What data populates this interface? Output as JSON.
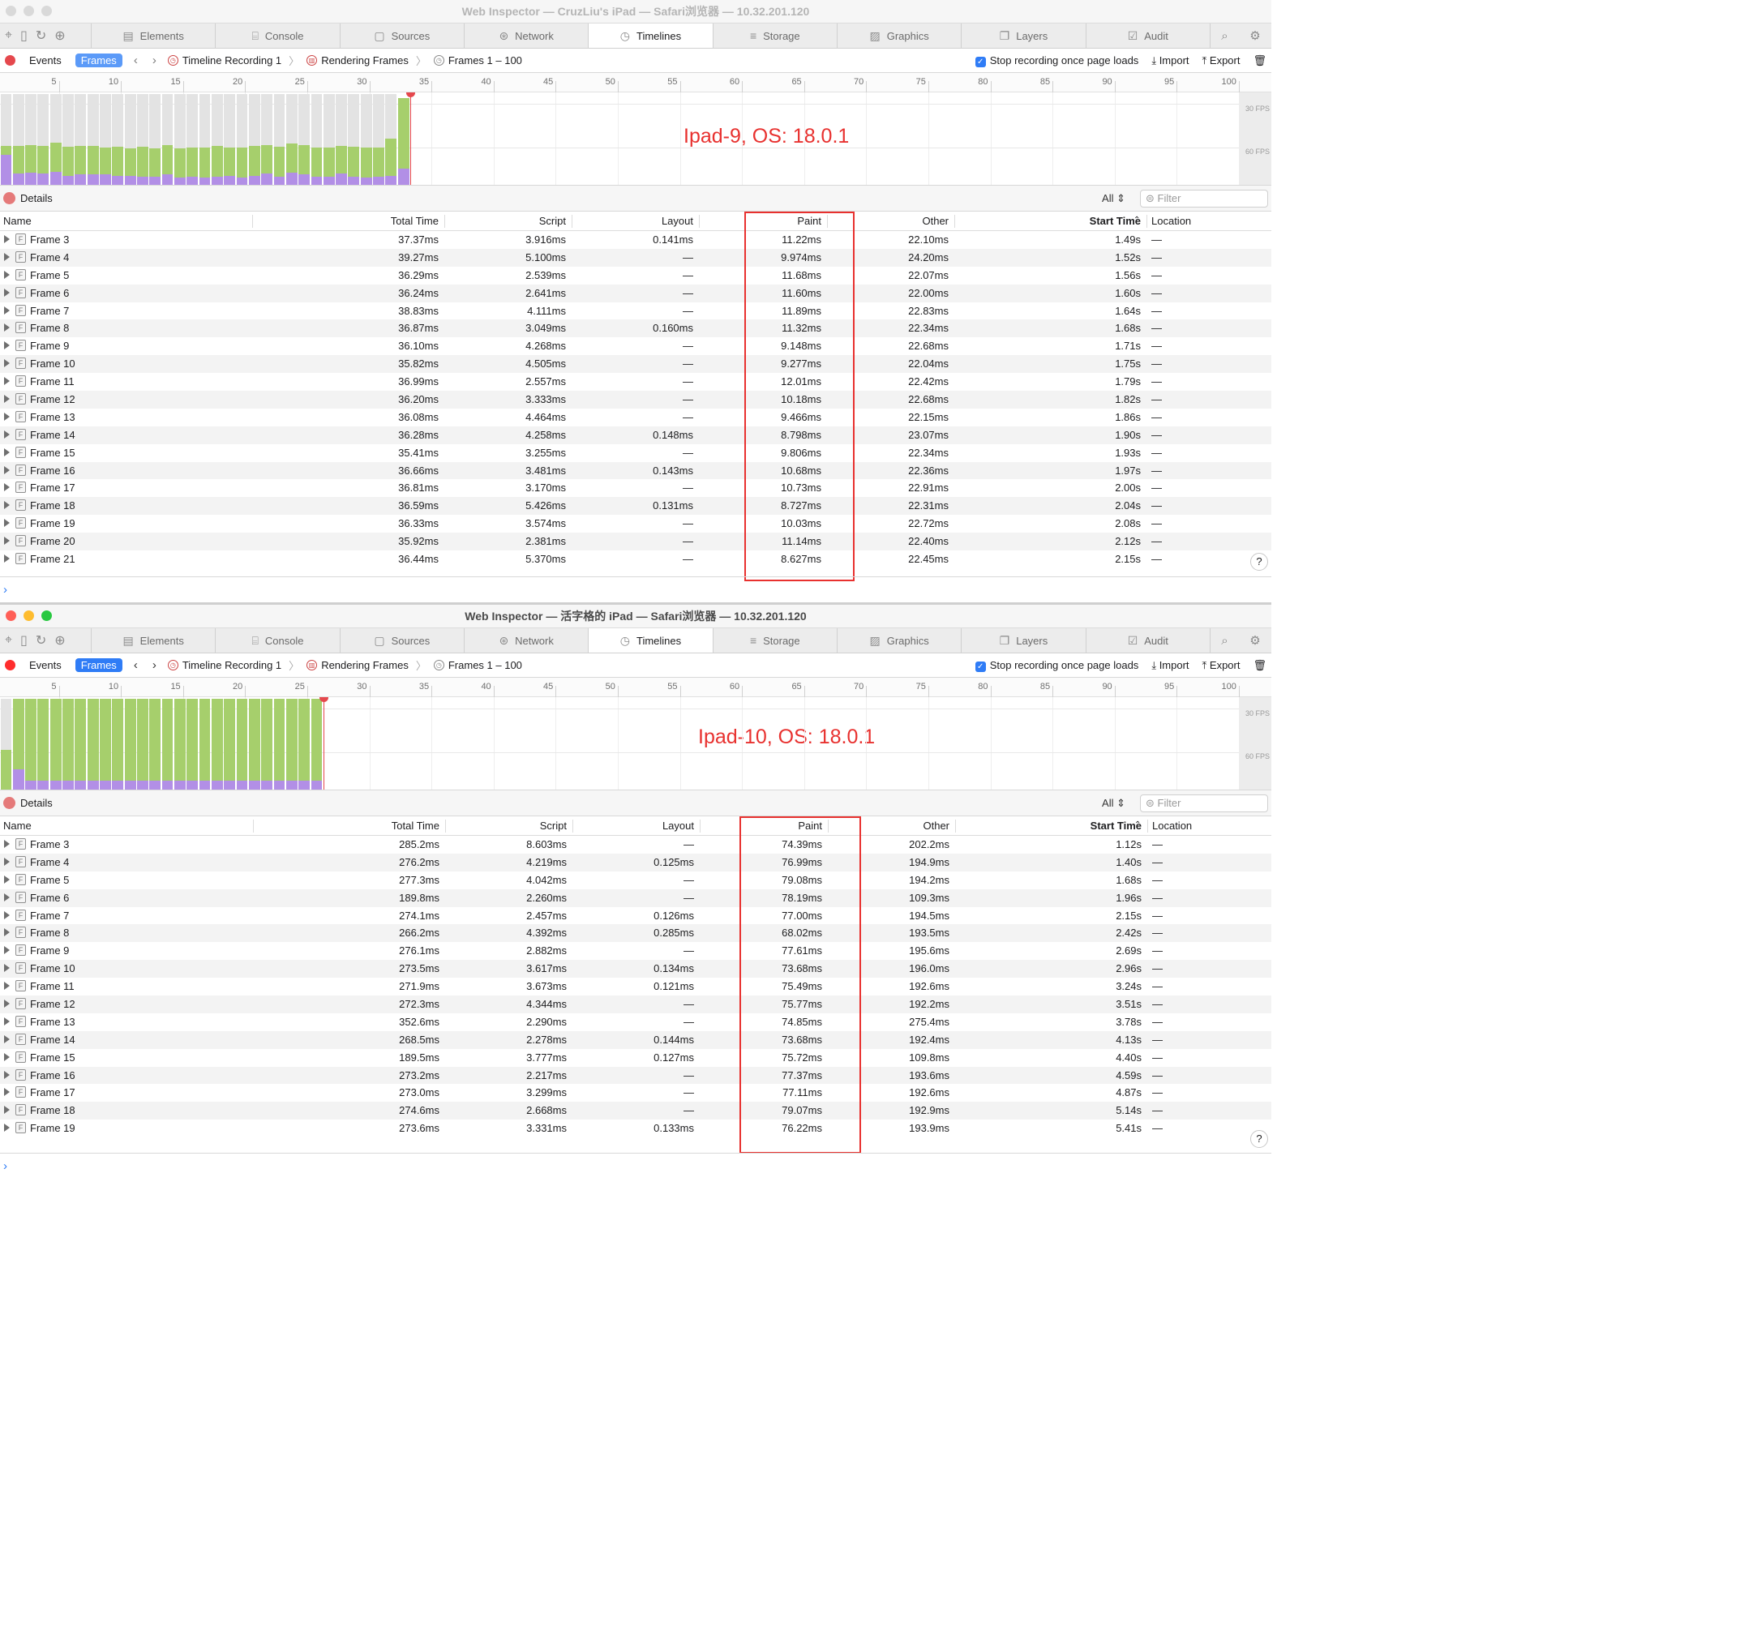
{
  "top": {
    "title": "Web Inspector — CruzLiu's iPad — Safari浏览器 — 10.32.201.120",
    "annotation": "Ipad-9, OS: 18.0.1",
    "frames_bar": {
      "fill_count": 33,
      "green_level": [
        0.42,
        0.42,
        0.43,
        0.42,
        0.45,
        0.41,
        0.42,
        0.42,
        0.4,
        0.41,
        0.39,
        0.41,
        0.39,
        0.43,
        0.39,
        0.4,
        0.4,
        0.42,
        0.4,
        0.4,
        0.42,
        0.43,
        0.41,
        0.44,
        0.43,
        0.4,
        0.4,
        0.42,
        0.41,
        0.4,
        0.4,
        0.5,
        0.93
      ],
      "purple_level": [
        0.32,
        0.12,
        0.13,
        0.12,
        0.14,
        0.1,
        0.11,
        0.11,
        0.11,
        0.1,
        0.1,
        0.09,
        0.09,
        0.11,
        0.08,
        0.09,
        0.08,
        0.09,
        0.1,
        0.08,
        0.1,
        0.12,
        0.09,
        0.13,
        0.11,
        0.09,
        0.09,
        0.12,
        0.09,
        0.08,
        0.09,
        0.1,
        0.17
      ]
    },
    "rows": [
      [
        "Frame 3",
        "37.37ms",
        "3.916ms",
        "0.141ms",
        "11.22ms",
        "22.10ms",
        "1.49s",
        "—"
      ],
      [
        "Frame 4",
        "39.27ms",
        "5.100ms",
        "—",
        "9.974ms",
        "24.20ms",
        "1.52s",
        "—"
      ],
      [
        "Frame 5",
        "36.29ms",
        "2.539ms",
        "—",
        "11.68ms",
        "22.07ms",
        "1.56s",
        "—"
      ],
      [
        "Frame 6",
        "36.24ms",
        "2.641ms",
        "—",
        "11.60ms",
        "22.00ms",
        "1.60s",
        "—"
      ],
      [
        "Frame 7",
        "38.83ms",
        "4.111ms",
        "—",
        "11.89ms",
        "22.83ms",
        "1.64s",
        "—"
      ],
      [
        "Frame 8",
        "36.87ms",
        "3.049ms",
        "0.160ms",
        "11.32ms",
        "22.34ms",
        "1.68s",
        "—"
      ],
      [
        "Frame 9",
        "36.10ms",
        "4.268ms",
        "—",
        "9.148ms",
        "22.68ms",
        "1.71s",
        "—"
      ],
      [
        "Frame 10",
        "35.82ms",
        "4.505ms",
        "—",
        "9.277ms",
        "22.04ms",
        "1.75s",
        "—"
      ],
      [
        "Frame 11",
        "36.99ms",
        "2.557ms",
        "—",
        "12.01ms",
        "22.42ms",
        "1.79s",
        "—"
      ],
      [
        "Frame 12",
        "36.20ms",
        "3.333ms",
        "—",
        "10.18ms",
        "22.68ms",
        "1.82s",
        "—"
      ],
      [
        "Frame 13",
        "36.08ms",
        "4.464ms",
        "—",
        "9.466ms",
        "22.15ms",
        "1.86s",
        "—"
      ],
      [
        "Frame 14",
        "36.28ms",
        "4.258ms",
        "0.148ms",
        "8.798ms",
        "23.07ms",
        "1.90s",
        "—"
      ],
      [
        "Frame 15",
        "35.41ms",
        "3.255ms",
        "—",
        "9.806ms",
        "22.34ms",
        "1.93s",
        "—"
      ],
      [
        "Frame 16",
        "36.66ms",
        "3.481ms",
        "0.143ms",
        "10.68ms",
        "22.36ms",
        "1.97s",
        "—"
      ],
      [
        "Frame 17",
        "36.81ms",
        "3.170ms",
        "—",
        "10.73ms",
        "22.91ms",
        "2.00s",
        "—"
      ],
      [
        "Frame 18",
        "36.59ms",
        "5.426ms",
        "0.131ms",
        "8.727ms",
        "22.31ms",
        "2.04s",
        "—"
      ],
      [
        "Frame 19",
        "36.33ms",
        "3.574ms",
        "—",
        "10.03ms",
        "22.72ms",
        "2.08s",
        "—"
      ],
      [
        "Frame 20",
        "35.92ms",
        "2.381ms",
        "—",
        "11.14ms",
        "22.40ms",
        "2.12s",
        "—"
      ],
      [
        "Frame 21",
        "36.44ms",
        "5.370ms",
        "—",
        "8.627ms",
        "22.45ms",
        "2.15s",
        "—"
      ]
    ]
  },
  "bottom": {
    "title": "Web Inspector — 活字格的 iPad — Safari浏览器 — 10.32.201.120",
    "annotation": "Ipad-10, OS: 18.0.1",
    "frames_bar": {
      "fill_count": 26
    },
    "rows": [
      [
        "Frame 3",
        "285.2ms",
        "8.603ms",
        "—",
        "74.39ms",
        "202.2ms",
        "1.12s",
        "—"
      ],
      [
        "Frame 4",
        "276.2ms",
        "4.219ms",
        "0.125ms",
        "76.99ms",
        "194.9ms",
        "1.40s",
        "—"
      ],
      [
        "Frame 5",
        "277.3ms",
        "4.042ms",
        "—",
        "79.08ms",
        "194.2ms",
        "1.68s",
        "—"
      ],
      [
        "Frame 6",
        "189.8ms",
        "2.260ms",
        "—",
        "78.19ms",
        "109.3ms",
        "1.96s",
        "—"
      ],
      [
        "Frame 7",
        "274.1ms",
        "2.457ms",
        "0.126ms",
        "77.00ms",
        "194.5ms",
        "2.15s",
        "—"
      ],
      [
        "Frame 8",
        "266.2ms",
        "4.392ms",
        "0.285ms",
        "68.02ms",
        "193.5ms",
        "2.42s",
        "—"
      ],
      [
        "Frame 9",
        "276.1ms",
        "2.882ms",
        "—",
        "77.61ms",
        "195.6ms",
        "2.69s",
        "—"
      ],
      [
        "Frame 10",
        "273.5ms",
        "3.617ms",
        "0.134ms",
        "73.68ms",
        "196.0ms",
        "2.96s",
        "—"
      ],
      [
        "Frame 11",
        "271.9ms",
        "3.673ms",
        "0.121ms",
        "75.49ms",
        "192.6ms",
        "3.24s",
        "—"
      ],
      [
        "Frame 12",
        "272.3ms",
        "4.344ms",
        "—",
        "75.77ms",
        "192.2ms",
        "3.51s",
        "—"
      ],
      [
        "Frame 13",
        "352.6ms",
        "2.290ms",
        "—",
        "74.85ms",
        "275.4ms",
        "3.78s",
        "—"
      ],
      [
        "Frame 14",
        "268.5ms",
        "2.278ms",
        "0.144ms",
        "73.68ms",
        "192.4ms",
        "4.13s",
        "—"
      ],
      [
        "Frame 15",
        "189.5ms",
        "3.777ms",
        "0.127ms",
        "75.72ms",
        "109.8ms",
        "4.40s",
        "—"
      ],
      [
        "Frame 16",
        "273.2ms",
        "2.217ms",
        "—",
        "77.37ms",
        "193.6ms",
        "4.59s",
        "—"
      ],
      [
        "Frame 17",
        "273.0ms",
        "3.299ms",
        "—",
        "77.11ms",
        "192.6ms",
        "4.87s",
        "—"
      ],
      [
        "Frame 18",
        "274.6ms",
        "2.668ms",
        "—",
        "79.07ms",
        "192.9ms",
        "5.14s",
        "—"
      ],
      [
        "Frame 19",
        "273.6ms",
        "3.331ms",
        "0.133ms",
        "76.22ms",
        "193.9ms",
        "5.41s",
        "—"
      ]
    ]
  },
  "tabs": [
    "Elements",
    "Console",
    "Sources",
    "Network",
    "Timelines",
    "Storage",
    "Graphics",
    "Layers",
    "Audit"
  ],
  "tab_icons": [
    "layout-icon",
    "console-icon",
    "file-icon",
    "network-icon",
    "clock-icon",
    "storage-icon",
    "image-icon",
    "layers-icon",
    "audit-icon"
  ],
  "nav": {
    "events": "Events",
    "frames": "Frames",
    "crumb1": "Timeline Recording 1",
    "crumb2": "Rendering Frames",
    "crumb3": "Frames 1 – 100",
    "stop_label": "Stop recording once page loads",
    "import": "Import",
    "export": "Export"
  },
  "ruler_ticks": [
    "5",
    "10",
    "15",
    "20",
    "25",
    "30",
    "35",
    "40",
    "45",
    "50",
    "55",
    "60",
    "65",
    "70",
    "75",
    "80",
    "85",
    "90",
    "95",
    "100"
  ],
  "fps_labels": [
    "30 FPS",
    "60 FPS"
  ],
  "details": {
    "label": "Details",
    "scope": "All",
    "filter_placeholder": "Filter"
  },
  "columns": [
    "Name",
    "Total Time",
    "Script",
    "Layout",
    "Paint",
    "Other",
    "Start Time",
    "Location"
  ],
  "help": "?",
  "console_prompt": "›",
  "colors": {
    "accent": "#2f7cf6",
    "annotation": "#e8312f",
    "script_bar": "#b28fe6",
    "paint_bar": "#a6cf6c"
  }
}
